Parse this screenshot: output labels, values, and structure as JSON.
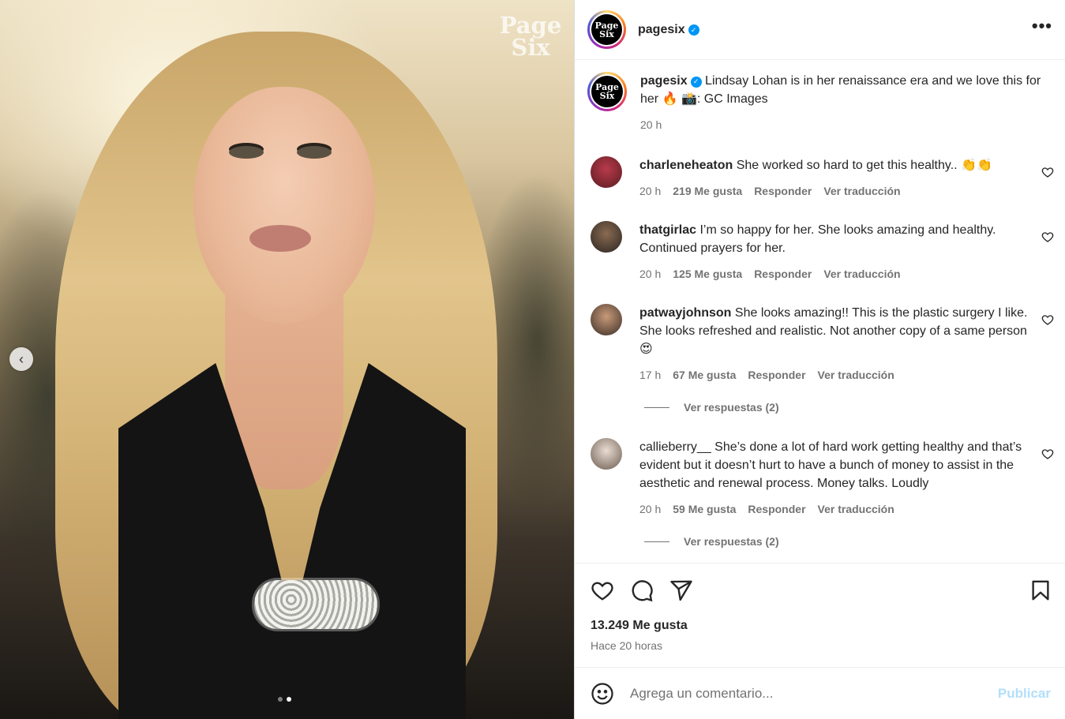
{
  "media": {
    "watermark_line1": "Page",
    "watermark_line2": "Six",
    "prev_arrow": "‹",
    "carousel_total": 2,
    "carousel_active": 2
  },
  "post": {
    "account": "pagesix",
    "logo_line1": "Page",
    "logo_line2": "Six",
    "more_label": "•••",
    "caption_text": "Lindsay Lohan is in her renaissance era and we love this for her 🔥 📸: GC Images",
    "caption_time": "20 h",
    "likes": "13.249 Me gusta",
    "posted_ago": "Hace 20 horas"
  },
  "comments": [
    {
      "user": "charleneheaton",
      "text": "She worked so hard to get this healthy.. 👏👏",
      "time": "20 h",
      "likes": "219 Me gusta",
      "reply": "Responder",
      "translate": "Ver traducción"
    },
    {
      "user": "thatgirlac",
      "text": "I’m so happy for her. She looks amazing and healthy. Continued prayers for her.",
      "time": "20 h",
      "likes": "125 Me gusta",
      "reply": "Responder",
      "translate": "Ver traducción"
    },
    {
      "user": "patwayjohnson",
      "text": "She looks amazing!! This is the plastic surgery I like. She looks refreshed and realistic. Not another copy of a same person 😍",
      "time": "17 h",
      "likes": "67 Me gusta",
      "reply": "Responder",
      "translate": "Ver traducción",
      "view_replies": "Ver respuestas (2)"
    },
    {
      "user": "callieberry__",
      "text": "She’s done a lot of hard work getting healthy and that’s evident but it doesn’t hurt to have a bunch of money to assist in the aesthetic and renewal process. Money talks. Loudly",
      "time": "20 h",
      "likes": "59 Me gusta",
      "reply": "Responder",
      "translate": "Ver traducción",
      "view_replies": "Ver respuestas (2)"
    }
  ],
  "composer": {
    "placeholder": "Agrega un comentario...",
    "post_label": "Publicar"
  },
  "colors": {
    "verified": "#0095f6",
    "publish_disabled": "#b2dffc",
    "secondary_text": "#737373"
  },
  "icons": [
    "chevron-left-icon",
    "verified-icon",
    "more-icon",
    "heart-icon",
    "comment-icon",
    "share-icon",
    "bookmark-icon",
    "emoji-icon"
  ]
}
